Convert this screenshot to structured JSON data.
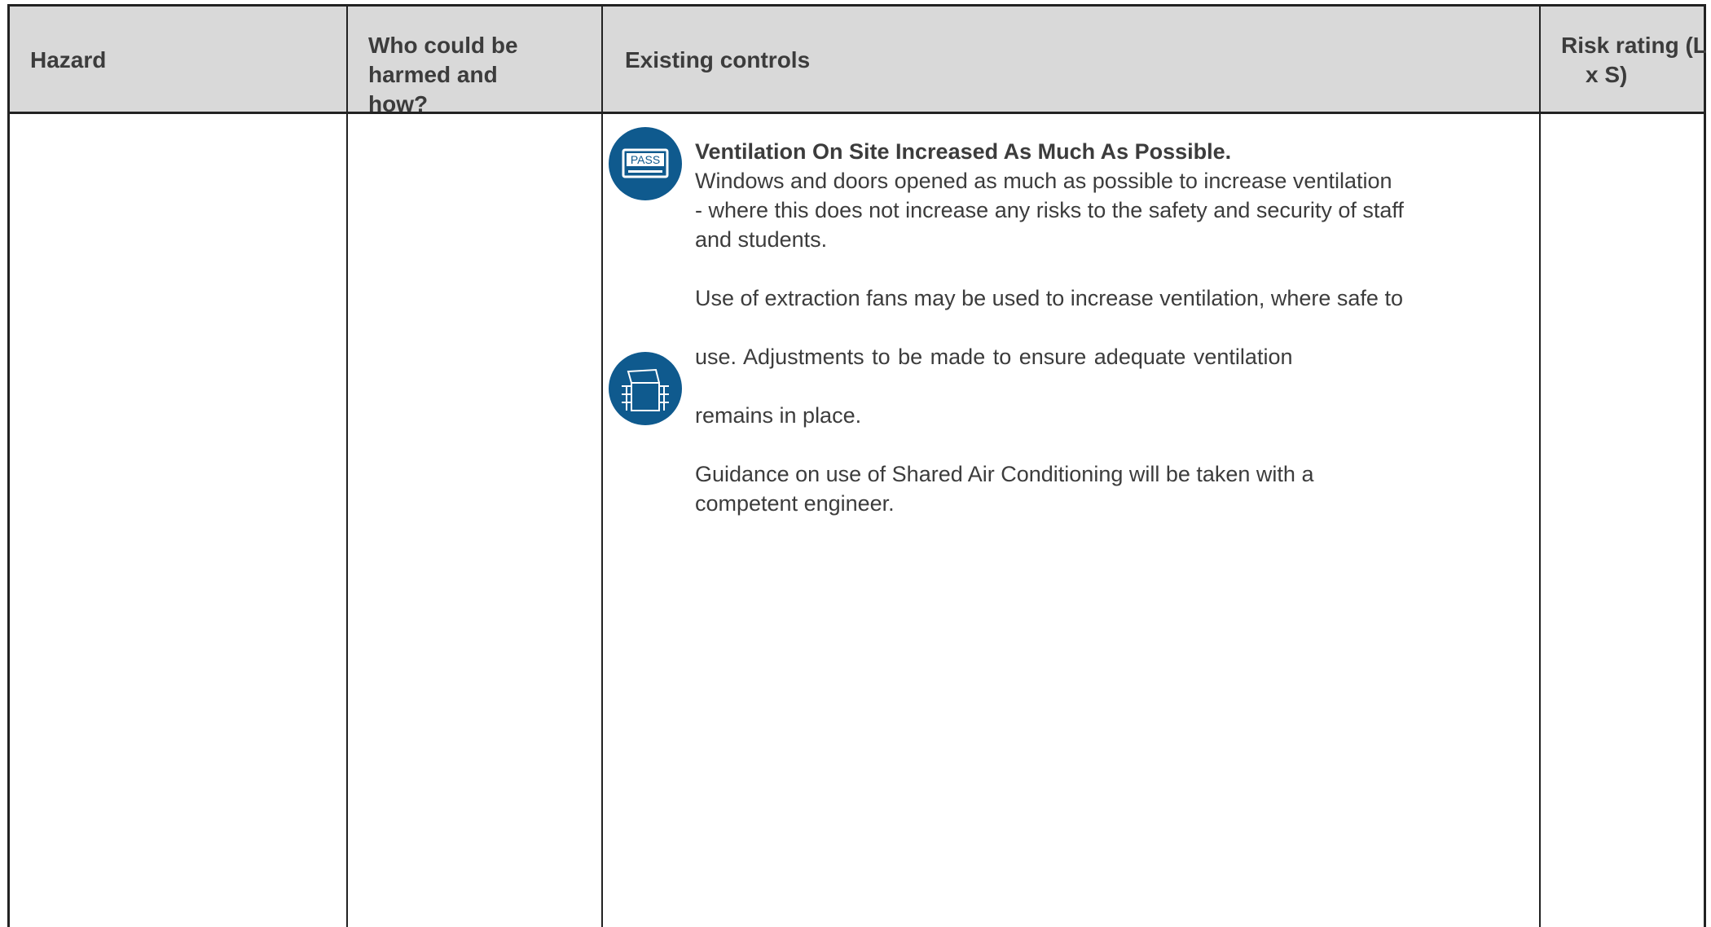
{
  "table": {
    "headers": {
      "hazard": "Hazard",
      "who": "Who could be harmed and how?",
      "controls": "Existing controls",
      "risk": "Risk rating (L x S)"
    },
    "row": {
      "title": "Ventilation On Site Increased As Much As Possible.",
      "p1": "Windows and doors opened as much as possible to increase ventilation - where this does not increase any risks to the safety and security of staff and students.",
      "p2a": "Use of extraction fans may be used to increase ventilation, where safe to",
      "p2b": "use. Adjustments to be made to ensure adequate ventilation",
      "p2c": "remains in place.",
      "p3": "Guidance on use of Shared Air Conditioning will be taken with a competent engineer."
    },
    "icons": [
      "pass-card-icon",
      "open-box-icon"
    ],
    "icon_label": "PASS",
    "colors": {
      "header_bg": "#d9d9d9",
      "icon_bg": "#0f5a8e",
      "border": "#222222"
    }
  }
}
